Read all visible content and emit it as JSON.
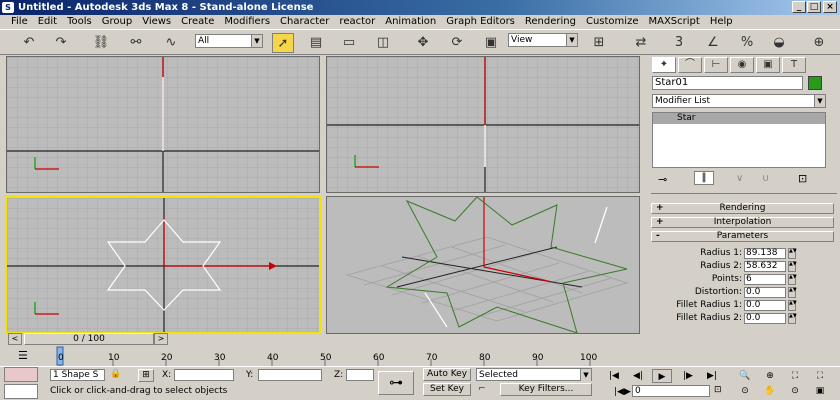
{
  "window": {
    "title": "Untitled - Autodesk 3ds Max 8 - Stand-alone License",
    "app_icon": "S"
  },
  "window_controls": {
    "minimize": "_",
    "maximize": "□",
    "close": "×"
  },
  "menu": [
    "File",
    "Edit",
    "Tools",
    "Group",
    "Views",
    "Create",
    "Modifiers",
    "Character",
    "reactor",
    "Animation",
    "Graph Editors",
    "Rendering",
    "Customize",
    "MAXScript",
    "Help"
  ],
  "toolbar": {
    "undo": "↶",
    "redo": "↷",
    "link": "⛓",
    "unlink": "⚯",
    "bind": "∿",
    "selection_filter": "All",
    "select": "➚",
    "select_by_name": "▤",
    "rect_region": "▭",
    "window_crossing": "◫",
    "move": "✥",
    "rotate": "⟳",
    "scale": "▣",
    "ref_coord": "View",
    "pivot": "⊞",
    "select_manip": "⇄",
    "snap": "3",
    "angle_snap": "∠",
    "percent_snap": "%",
    "spinner_snap": "◒",
    "named_sel": "⊕"
  },
  "command_panel": {
    "tabs": [
      "✦",
      "⌒",
      "⊢",
      "◉",
      "▣",
      "T"
    ],
    "object_name": "Star01",
    "object_color": "#2a9a1a",
    "modifier_list": "Modifier List",
    "stack_item": "Star",
    "stack_tools": [
      "⊸",
      "‖",
      "∨",
      "∪",
      "⊡"
    ],
    "rollouts": [
      {
        "sign": "+",
        "label": "Rendering"
      },
      {
        "sign": "+",
        "label": "Interpolation"
      },
      {
        "sign": "-",
        "label": "Parameters"
      }
    ],
    "parameters": [
      {
        "label": "Radius 1:",
        "value": "89.138"
      },
      {
        "label": "Radius 2:",
        "value": "58.632"
      },
      {
        "label": "Points:",
        "value": "6"
      },
      {
        "label": "Distortion:",
        "value": "0.0"
      },
      {
        "label": "Fillet Radius 1:",
        "value": "0.0"
      },
      {
        "label": "Fillet Radius 2:",
        "value": "0.0"
      }
    ]
  },
  "timeline": {
    "frame": "0 / 100",
    "prev": "<",
    "next": ">",
    "ticks": [
      "0",
      "10",
      "20",
      "30",
      "40",
      "50",
      "60",
      "70",
      "80",
      "90",
      "100"
    ]
  },
  "status": {
    "selection": "1 Shape S",
    "lock": "🔒",
    "abs_mode": "⊞",
    "x_label": "X:",
    "x_value": "",
    "y_label": "Y:",
    "y_value": "",
    "z_label": "Z:",
    "z_value": "",
    "prompt": "Click or click-and-drag to select objects",
    "key_icon": "⊶",
    "auto_key": "Auto Key",
    "set_key": "Set Key",
    "key_mode_value": "Selected",
    "key_filters": "Key Filters...",
    "frame_field": "0",
    "playback": [
      "|◀",
      "◀|",
      "▶",
      "|▶",
      "▶|"
    ],
    "nav": [
      "🔍",
      "⊕",
      "⛶",
      "⛶",
      "⊙",
      "✋",
      "⊙",
      "▣"
    ]
  }
}
